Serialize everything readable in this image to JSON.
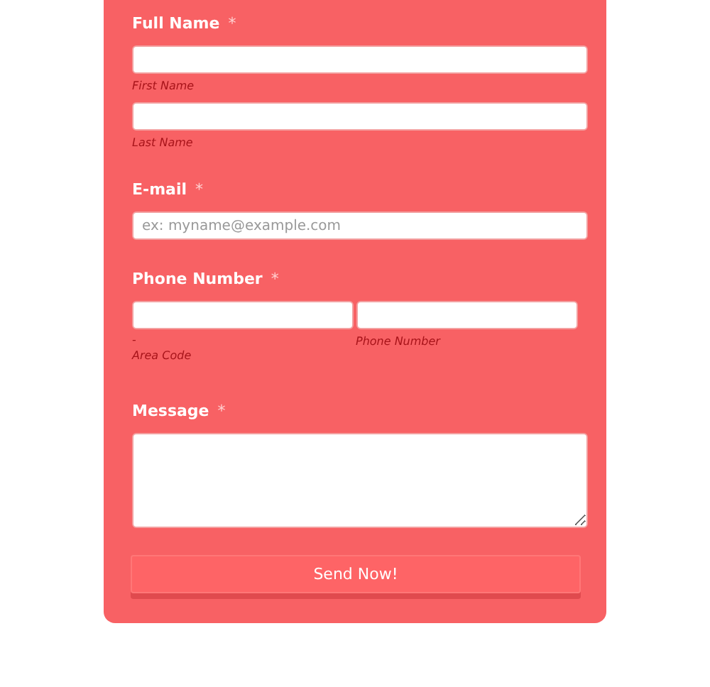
{
  "form": {
    "fields": [
      {
        "kind": "name",
        "label": "Full Name",
        "required_mark": "*",
        "sublabels": [
          "First Name",
          "Last Name"
        ]
      },
      {
        "kind": "email",
        "label": "E-mail",
        "required_mark": "*",
        "placeholder": "ex: myname@example.com"
      },
      {
        "kind": "phone",
        "label": "Phone Number",
        "required_mark": "*",
        "separator": "-",
        "sublabels": [
          "Area Code",
          "Phone Number"
        ]
      },
      {
        "kind": "textarea",
        "label": "Message",
        "required_mark": "*"
      }
    ],
    "submit": "Send Now!"
  }
}
